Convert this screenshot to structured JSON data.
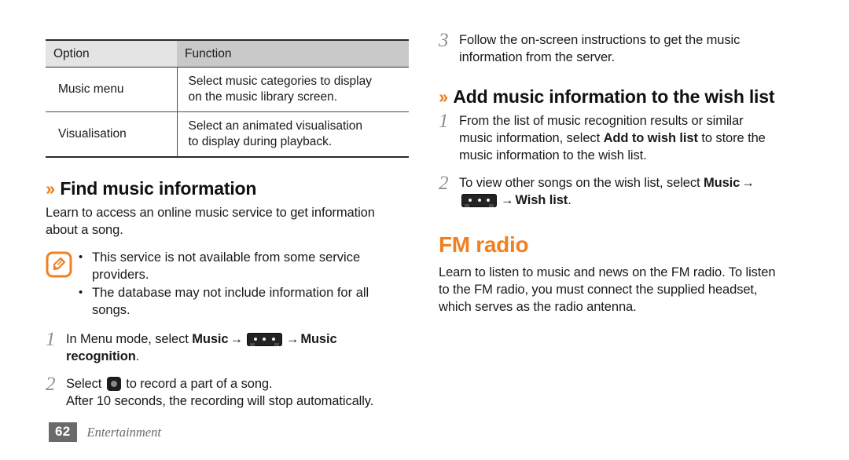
{
  "table": {
    "headers": [
      "Option",
      "Function"
    ],
    "rows": [
      {
        "option": "Music menu",
        "function_line1": "Select music categories to display",
        "function_line2": "on the music library screen."
      },
      {
        "option": "Visualisation",
        "function_line1": "Select an animated visualisation",
        "function_line2": "to display during playback."
      }
    ]
  },
  "find_music": {
    "chevron": "››",
    "heading": "Find music information",
    "intro_line1": "Learn to access an online music service to get information",
    "intro_line2": "about a song.",
    "note": {
      "icon": "note-pencil-icon",
      "bullets": [
        {
          "line1": "This service is not available from some service",
          "line2": "providers."
        },
        {
          "line1": "The database may not include information for all",
          "line2": "songs."
        }
      ]
    },
    "steps": [
      {
        "num": "1",
        "text_before": "In Menu mode, select ",
        "bold1": "Music",
        "arrow1": "→",
        "icon": "more-options-icon",
        "arrow2": "→",
        "bold2": "Music",
        "bold2_cont": "recognition",
        "text_end": "."
      },
      {
        "num": "2",
        "text_before": "Select ",
        "icon": "record-button-icon",
        "text_after": " to record a part of a song.",
        "line2": "After 10 seconds, the recording will stop automatically."
      }
    ]
  },
  "right_column": {
    "step3": {
      "num": "3",
      "line1": "Follow the on-screen instructions to get the music",
      "line2": "information from the server."
    },
    "wishlist": {
      "chevron": "››",
      "heading": "Add music information to the wish list",
      "steps": [
        {
          "num": "1",
          "line1": "From the list of music recognition results or similar",
          "line2_a": "music information, select ",
          "line2_bold": "Add to wish list",
          "line2_b": " to store the",
          "line3": "music information to the wish list."
        },
        {
          "num": "2",
          "line1_a": "To view other songs on the wish list, select ",
          "line1_bold": "Music",
          "arrow1": "→",
          "icon": "more-options-icon",
          "arrow2": "→",
          "line2_bold": "Wish list",
          "line2_end": "."
        }
      ]
    },
    "fm_radio": {
      "heading": "FM radio",
      "para_line1": "Learn to listen to music and news on the FM radio. To listen",
      "para_line2": "to the FM radio, you must connect the supplied headset,",
      "para_line3": "which serves as the radio antenna."
    }
  },
  "footer": {
    "page_number": "62",
    "chapter": "Entertainment"
  },
  "colors": {
    "accent_orange": "#f08020",
    "heading_black": "#111111",
    "footer_gray": "#6a6a6a",
    "table_header_light": "#e4e4e4",
    "table_header_dark": "#c9c9c9"
  }
}
